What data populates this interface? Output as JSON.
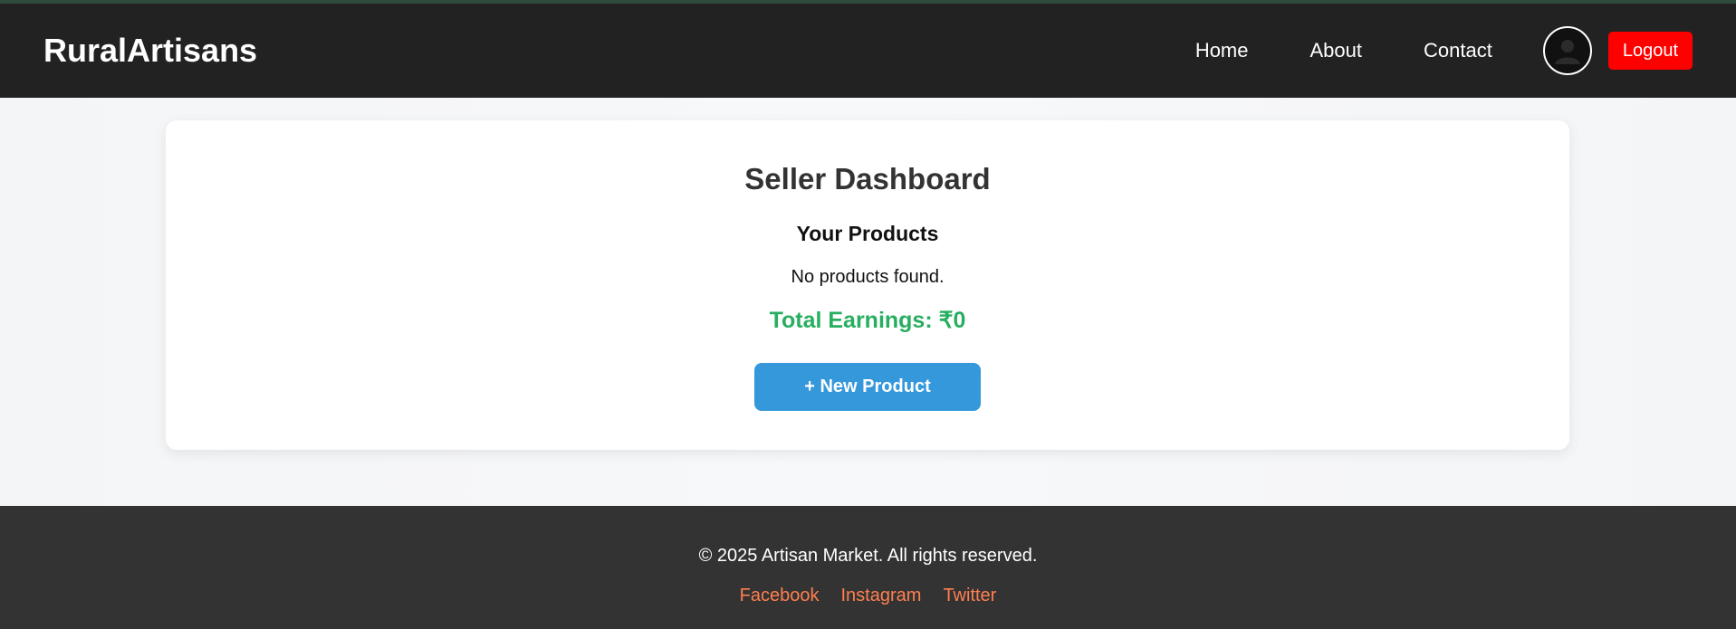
{
  "colors": {
    "navbar_bg": "#222222",
    "logout_bg": "#ff0000",
    "earnings_text": "#27ae60",
    "primary_button": "#3498db",
    "footer_bg": "#333333",
    "footer_link": "#ff7f50"
  },
  "navbar": {
    "brand": "RuralArtisans",
    "links": [
      {
        "label": "Home"
      },
      {
        "label": "About"
      },
      {
        "label": "Contact"
      }
    ],
    "avatar_icon": "user-avatar-icon",
    "logout_label": "Logout"
  },
  "dashboard": {
    "title": "Seller Dashboard",
    "products_heading": "Your Products",
    "empty_message": "No products found.",
    "earnings_text": "Total Earnings: ₹0",
    "new_product_label": "+ New Product"
  },
  "footer": {
    "copyright": "© 2025 Artisan Market. All rights reserved.",
    "social_links": [
      {
        "label": "Facebook"
      },
      {
        "label": "Instagram"
      },
      {
        "label": "Twitter"
      }
    ]
  }
}
